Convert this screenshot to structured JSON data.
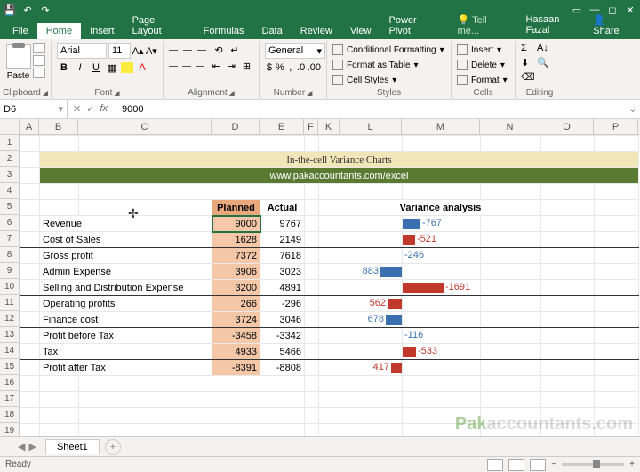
{
  "app": {
    "cell_ref": "D6",
    "formula_value": "9000",
    "status": "Ready"
  },
  "tabs": {
    "file": "File",
    "home": "Home",
    "insert": "Insert",
    "pagelayout": "Page Layout",
    "formulas": "Formulas",
    "data": "Data",
    "review": "Review",
    "view": "View",
    "powerpivot": "Power Pivot",
    "tellme": "Tell me...",
    "user": "Hasaan Fazal",
    "share": "Share"
  },
  "ribbon": {
    "clipboard": {
      "paste": "Paste",
      "label": "Clipboard"
    },
    "font": {
      "name": "Arial",
      "size": "11",
      "label": "Font",
      "bold": "B",
      "italic": "I",
      "underline": "U"
    },
    "alignment": {
      "label": "Alignment"
    },
    "number": {
      "format": "General",
      "label": "Number"
    },
    "styles": {
      "cond": "Conditional Formatting",
      "table": "Format as Table",
      "cell": "Cell Styles",
      "label": "Styles"
    },
    "cells": {
      "insert": "Insert",
      "delete": "Delete",
      "format": "Format",
      "label": "Cells"
    },
    "editing": {
      "label": "Editing"
    }
  },
  "cols": [
    "A",
    "B",
    "C",
    "D",
    "E",
    "F",
    "K",
    "L",
    "M",
    "N",
    "O",
    "P"
  ],
  "rows": [
    "1",
    "2",
    "3",
    "4",
    "5",
    "6",
    "7",
    "8",
    "9",
    "10",
    "11",
    "12",
    "13",
    "14",
    "15",
    "16",
    "17",
    "18",
    "19"
  ],
  "content": {
    "title": "In-the-cell Variance Charts",
    "link": "www.pakaccountants.com/excel",
    "hdr_planned": "Planned",
    "hdr_actual": "Actual",
    "hdr_variance": "Variance analysis",
    "items": [
      {
        "label": "Revenue",
        "planned": "9000",
        "actual": "9767",
        "var": "-767",
        "neg": false,
        "pos": "R",
        "bw": 20
      },
      {
        "label": "Cost of Sales",
        "planned": "1628",
        "actual": "2149",
        "var": "-521",
        "neg": true,
        "pos": "R",
        "bw": 14,
        "ul": true
      },
      {
        "label": "Gross profit",
        "planned": "7372",
        "actual": "7618",
        "var": "-246",
        "neg": false,
        "pos": "R",
        "bw": 0
      },
      {
        "label": "Admin Expense",
        "planned": "3906",
        "actual": "3023",
        "var": "883",
        "neg": false,
        "pos": "L",
        "bw": 24
      },
      {
        "label": "Selling and Distribution Expense",
        "planned": "3200",
        "actual": "4891",
        "var": "-1691",
        "neg": true,
        "pos": "R",
        "bw": 46,
        "ul": true
      },
      {
        "label": "Operating profits",
        "planned": "266",
        "actual": "-296",
        "var": "562",
        "neg": true,
        "pos": "L",
        "bw": 16
      },
      {
        "label": "Finance cost",
        "planned": "3724",
        "actual": "3046",
        "var": "678",
        "neg": false,
        "pos": "L",
        "bw": 18,
        "ul": true
      },
      {
        "label": "Profit before Tax",
        "planned": "-3458",
        "actual": "-3342",
        "var": "-116",
        "neg": false,
        "pos": "R",
        "bw": 0
      },
      {
        "label": "Tax",
        "planned": "4933",
        "actual": "5466",
        "var": "-533",
        "neg": true,
        "pos": "R",
        "bw": 15,
        "ul": true
      },
      {
        "label": "Profit after Tax",
        "planned": "-8391",
        "actual": "-8808",
        "var": "417",
        "neg": true,
        "pos": "L",
        "bw": 12
      }
    ]
  },
  "chart_data": {
    "type": "bar",
    "title": "In-the-cell Variance Charts",
    "categories": [
      "Revenue",
      "Cost of Sales",
      "Gross profit",
      "Admin Expense",
      "Selling and Distribution Expense",
      "Operating profits",
      "Finance cost",
      "Profit before Tax",
      "Tax",
      "Profit after Tax"
    ],
    "series": [
      {
        "name": "Planned",
        "values": [
          9000,
          1628,
          7372,
          3906,
          3200,
          266,
          3724,
          -3458,
          4933,
          -8391
        ]
      },
      {
        "name": "Actual",
        "values": [
          9767,
          2149,
          7618,
          3023,
          4891,
          -296,
          3046,
          -3342,
          5466,
          -8808
        ]
      },
      {
        "name": "Variance",
        "values": [
          -767,
          -521,
          -246,
          883,
          -1691,
          562,
          678,
          -116,
          -533,
          417
        ]
      }
    ]
  },
  "sheets": {
    "tab1": "Sheet1"
  },
  "watermark": {
    "a": "Pak",
    "b": "accountants.com"
  }
}
